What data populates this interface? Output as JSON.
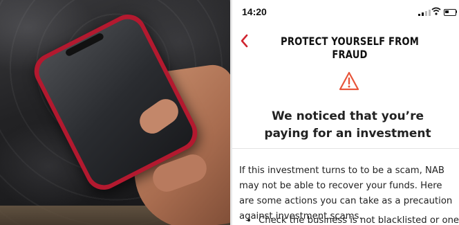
{
  "colors": {
    "accent": "#d0242f",
    "warning": "#e8553a",
    "phone_case": "#b3192f"
  },
  "status_bar": {
    "time": "14:20"
  },
  "header": {
    "back_icon": "chevron-left-icon",
    "title": "PROTECT YOURSELF FROM FRAUD"
  },
  "notice": {
    "icon": "warning-triangle-icon",
    "heading": "We noticed that you’re paying for an investment"
  },
  "body": {
    "paragraph": "If this investment turns to to be a scam, NAB may not be able to recover your funds. Here are some actions you can take as a precaution against investment scams.",
    "bullets": [
      "Check the business is not blacklisted or one you"
    ]
  }
}
